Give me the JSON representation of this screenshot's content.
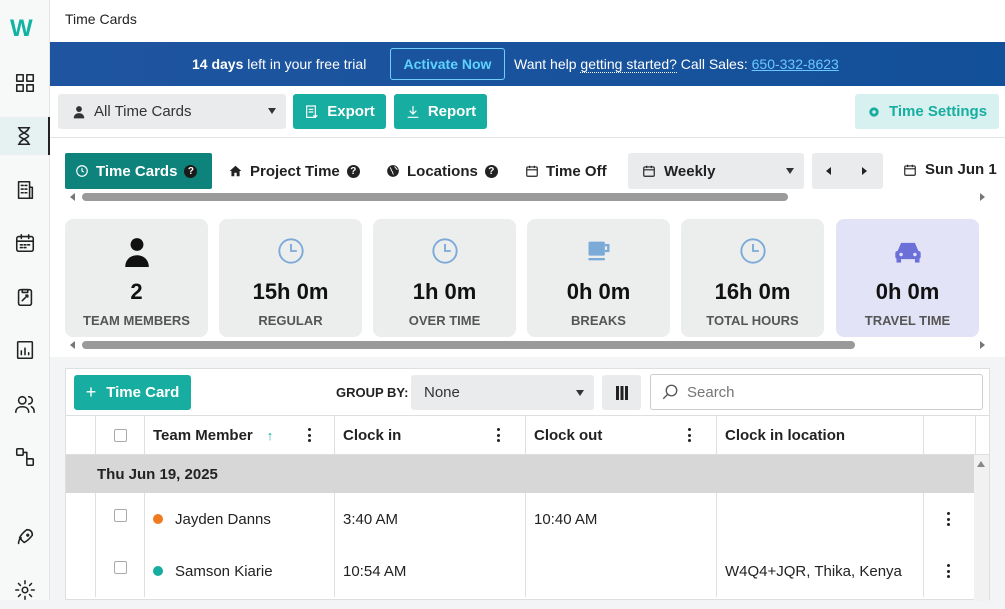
{
  "sidebar": {
    "logo": "W",
    "items": [
      {
        "name": "dashboard-icon"
      },
      {
        "name": "hourglass-icon",
        "active": true
      },
      {
        "name": "building-icon"
      },
      {
        "name": "calendar-icon"
      },
      {
        "name": "clipboard-icon"
      },
      {
        "name": "report-icon"
      },
      {
        "name": "users-icon"
      },
      {
        "name": "workflow-icon"
      },
      {
        "name": "rocket-icon"
      },
      {
        "name": "gear-icon"
      }
    ]
  },
  "header": {
    "title": "Time Cards"
  },
  "trial": {
    "days": "14 days",
    "text": " left in your free trial",
    "activate_label": "Activate Now",
    "help_prefix": "Want help ",
    "help_link": "getting started?",
    "call_text": " Call Sales: ",
    "phone": "650-332-8623"
  },
  "toolbar": {
    "filter_value": "All Time Cards",
    "export_label": "Export",
    "report_label": "Report",
    "settings_label": "Time Settings"
  },
  "tabs": {
    "time_cards": "Time Cards",
    "project_time": "Project Time",
    "locations": "Locations",
    "time_off": "Time Off",
    "q": "?"
  },
  "period": {
    "value": "Weekly",
    "date_label": "Sun Jun 1"
  },
  "stats": [
    {
      "value": "2",
      "label": "TEAM MEMBERS"
    },
    {
      "value": "15h 0m",
      "label": "REGULAR"
    },
    {
      "value": "1h 0m",
      "label": "OVER TIME"
    },
    {
      "value": "0h 0m",
      "label": "BREAKS"
    },
    {
      "value": "16h 0m",
      "label": "TOTAL HOURS"
    },
    {
      "value": "0h 0m",
      "label": "TRAVEL TIME"
    }
  ],
  "grid": {
    "add_label": "Time Card",
    "group_by_label": "GROUP BY:",
    "group_by_value": "None",
    "search_placeholder": "Search",
    "columns": {
      "member": "Team Member",
      "clock_in": "Clock in",
      "clock_out": "Clock out",
      "location": "Clock in location"
    },
    "group_title": "Thu Jun 19, 2025",
    "rows": [
      {
        "name": "Jayden Danns",
        "color": "#f07a1e",
        "clock_in": "3:40 AM",
        "clock_out": "10:40 AM",
        "location": ""
      },
      {
        "name": "Samson Kiarie",
        "color": "#17ada0",
        "clock_in": "10:54 AM",
        "clock_out": "",
        "location": "W4Q4+JQR, Thika, Kenya"
      }
    ]
  },
  "colors": {
    "accent": "#17ada0",
    "banner": "#1f55a0",
    "active_tab": "#0e837b"
  }
}
